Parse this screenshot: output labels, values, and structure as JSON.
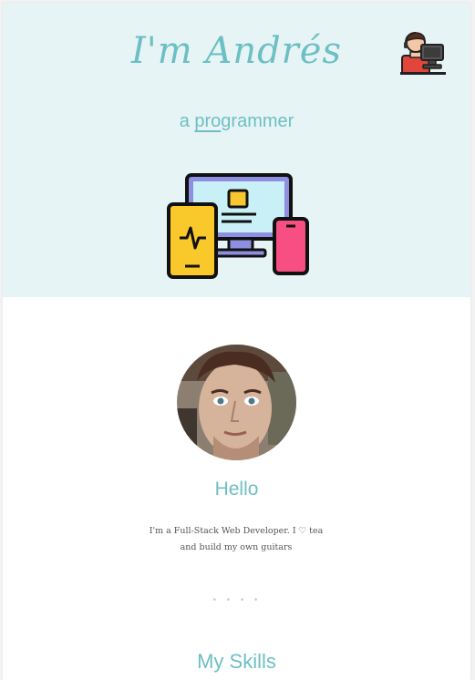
{
  "hero": {
    "title": "I'm Andrés",
    "tagline_pre": "a ",
    "tagline_highlight": "pro",
    "tagline_post": "grammer",
    "background": "#e7f4f5",
    "accent": "#6cbfc4",
    "avatar_icon": "programmer-avatar-icon",
    "illustration_icon": "devices-icon"
  },
  "profile": {
    "greeting": "Hello",
    "bio": "I'm a Full-Stack Web Developer. I ♡ tea and build my own guitars",
    "photo": "profile-photo"
  },
  "divider": "• • • •",
  "skills": {
    "heading": "My Skills"
  }
}
